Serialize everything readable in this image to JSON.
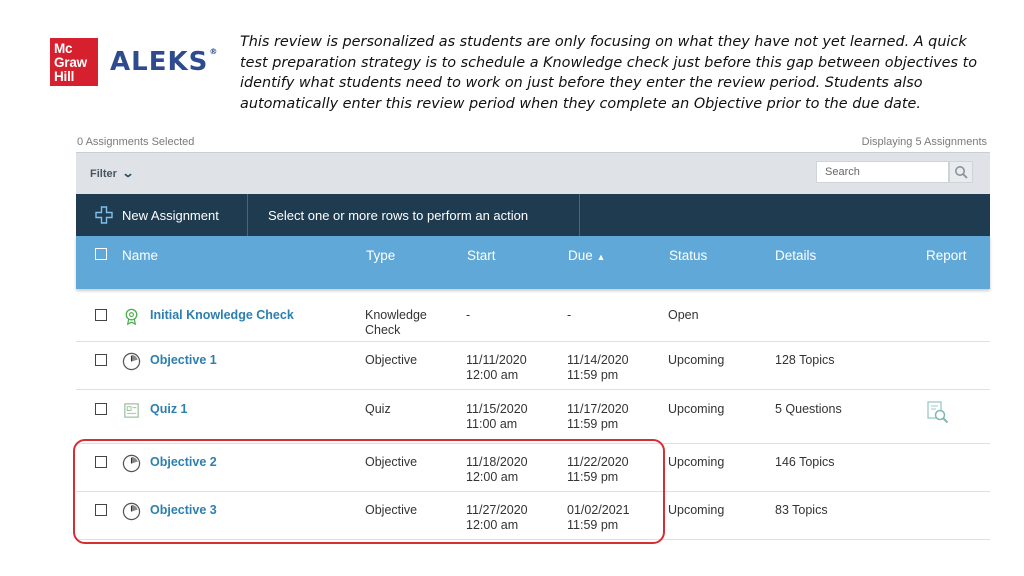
{
  "brand": {
    "publisher_logo_lines": [
      "Mc",
      "Graw",
      "Hill"
    ],
    "product_logo": "ALEKS",
    "product_logo_mark": "®",
    "colors": {
      "publisher": "#d6202d",
      "product": "#2f4b8f"
    }
  },
  "intro_text": "This review is personalized as students are only focusing on what they have not yet learned.  A quick test preparation strategy is to schedule a Knowledge check just before this gap between objectives to identify what students need to work on just before they enter the review period.  Students also automatically enter this review period when they complete an Objective prior to the due date.",
  "meta": {
    "selected": "0 Assignments Selected",
    "displaying": "Displaying 5 Assignments"
  },
  "filter": {
    "label": "Filter",
    "icon": "chevron-down-icon"
  },
  "search": {
    "placeholder": "Search",
    "icon": "search-icon"
  },
  "actions": {
    "new_assignment": "New Assignment",
    "new_icon": "plus-outline-icon",
    "message": "Select one or more rows to perform an action"
  },
  "columns": {
    "name": "Name",
    "type": "Type",
    "start": "Start",
    "due": "Due",
    "due_sort": "▲",
    "status": "Status",
    "details": "Details",
    "report": "Report"
  },
  "rows": [
    {
      "name": "Initial Knowledge Check",
      "icon": "knowledge-check-icon",
      "type_line1": "Knowledge",
      "type_line2": "Check",
      "start_date": "-",
      "start_time": "",
      "due_date": "-",
      "due_time": "",
      "status": "Open",
      "details": ""
    },
    {
      "name": "Objective 1",
      "icon": "objective-clock-icon",
      "type_line1": "Objective",
      "type_line2": "",
      "start_date": "11/11/2020",
      "start_time": "12:00 am",
      "due_date": "11/14/2020",
      "due_time": "11:59 pm",
      "status": "Upcoming",
      "details": "128 Topics"
    },
    {
      "name": "Quiz 1",
      "icon": "quiz-icon",
      "type_line1": "Quiz",
      "type_line2": "",
      "start_date": "11/15/2020",
      "start_time": "11:00 am",
      "due_date": "11/17/2020",
      "due_time": "11:59 pm",
      "status": "Upcoming",
      "details": "5 Questions",
      "report_icon": "report-magnifier-icon"
    },
    {
      "name": "Objective 2",
      "icon": "objective-clock-icon",
      "type_line1": "Objective",
      "type_line2": "",
      "start_date": "11/18/2020",
      "start_time": "12:00 am",
      "due_date": "11/22/2020",
      "due_time": "11:59 pm",
      "status": "Upcoming",
      "details": "146 Topics"
    },
    {
      "name": "Objective 3",
      "icon": "objective-clock-icon",
      "type_line1": "Objective",
      "type_line2": "",
      "start_date": "11/27/2020",
      "start_time": "12:00 am",
      "due_date": "01/02/2021",
      "due_time": "11:59 pm",
      "status": "Upcoming",
      "details": "83 Topics"
    }
  ],
  "highlight_color": "#d32f35"
}
